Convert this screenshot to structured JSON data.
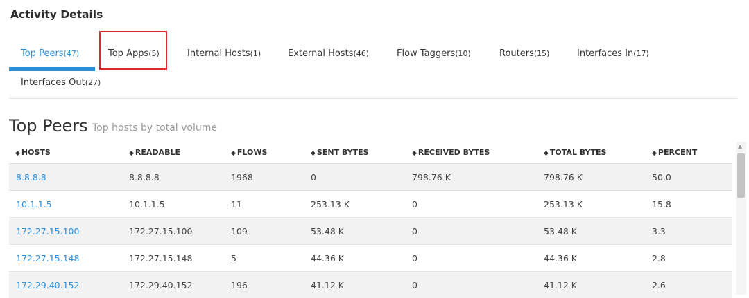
{
  "section_heading": "Activity Details",
  "tabs": [
    {
      "label": "Top Peers",
      "count": "(47)"
    },
    {
      "label": "Top Apps",
      "count": "(5)"
    },
    {
      "label": "Internal Hosts",
      "count": "(1)"
    },
    {
      "label": "External Hosts",
      "count": "(46)"
    },
    {
      "label": "Flow Taggers",
      "count": "(10)"
    },
    {
      "label": "Routers",
      "count": "(15)"
    },
    {
      "label": "Interfaces In",
      "count": "(17)"
    },
    {
      "label": "Interfaces Out",
      "count": "(27)"
    }
  ],
  "active_tab": "Top Peers",
  "highlighted_tab": "Top Apps",
  "highlight_color": "#e3262b",
  "accent_color": "#2d8ed6",
  "table": {
    "title": "Top Peers",
    "subtitle": "Top hosts by total volume",
    "sort_icon": "sort-icon",
    "columns": [
      "HOSTS",
      "READABLE",
      "FLOWS",
      "SENT BYTES",
      "RECEIVED BYTES",
      "TOTAL BYTES",
      "PERCENT"
    ],
    "rows": [
      [
        "8.8.8.8",
        "8.8.8.8",
        "1968",
        "0",
        "798.76 K",
        "798.76 K",
        "50.0"
      ],
      [
        "10.1.1.5",
        "10.1.1.5",
        "11",
        "253.13 K",
        "0",
        "253.13 K",
        "15.8"
      ],
      [
        "172.27.15.100",
        "172.27.15.100",
        "109",
        "53.48 K",
        "0",
        "53.48 K",
        "3.3"
      ],
      [
        "172.27.15.148",
        "172.27.15.148",
        "5",
        "44.36 K",
        "0",
        "44.36 K",
        "2.8"
      ],
      [
        "172.29.40.152",
        "172.29.40.152",
        "196",
        "41.12 K",
        "0",
        "41.12 K",
        "2.6"
      ]
    ]
  }
}
